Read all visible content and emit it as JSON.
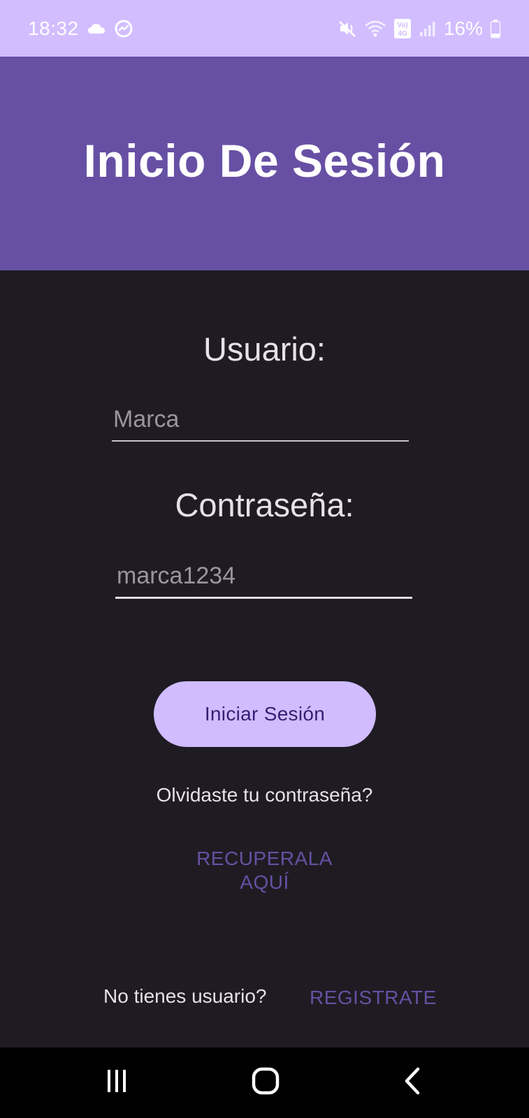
{
  "status_bar": {
    "time": "18:32",
    "battery": "16%",
    "icons_left": [
      "cloud-icon",
      "sync-icon"
    ],
    "icons_right": [
      "mute-icon",
      "wifi-icon",
      "volte-4g-icon",
      "signal-icon",
      "battery-icon"
    ],
    "volte_label": "Vo)\n4G"
  },
  "header": {
    "title": "Inicio De Sesión"
  },
  "form": {
    "user_label": "Usuario:",
    "user_value": "Marca",
    "password_label": "Contraseña:",
    "password_value": "marca1234",
    "login_button": "Iniciar Sesión"
  },
  "recovery": {
    "question": "Olvidaste tu contraseña?",
    "link_line1": "RECUPERALA",
    "link_line2": "AQUÍ"
  },
  "register": {
    "question": "No tienes usuario?",
    "link": "REGISTRATE"
  },
  "nav_bar": {
    "icons": [
      "recents-icon",
      "home-icon",
      "back-icon"
    ]
  },
  "colors": {
    "status_bar_bg": "#d2bdff",
    "header_bg": "#6750a4",
    "background": "#1e1c22",
    "button_bg": "#d0bcff",
    "button_text": "#381e72",
    "link": "#6750a4",
    "nav_bar_bg": "#000000"
  }
}
